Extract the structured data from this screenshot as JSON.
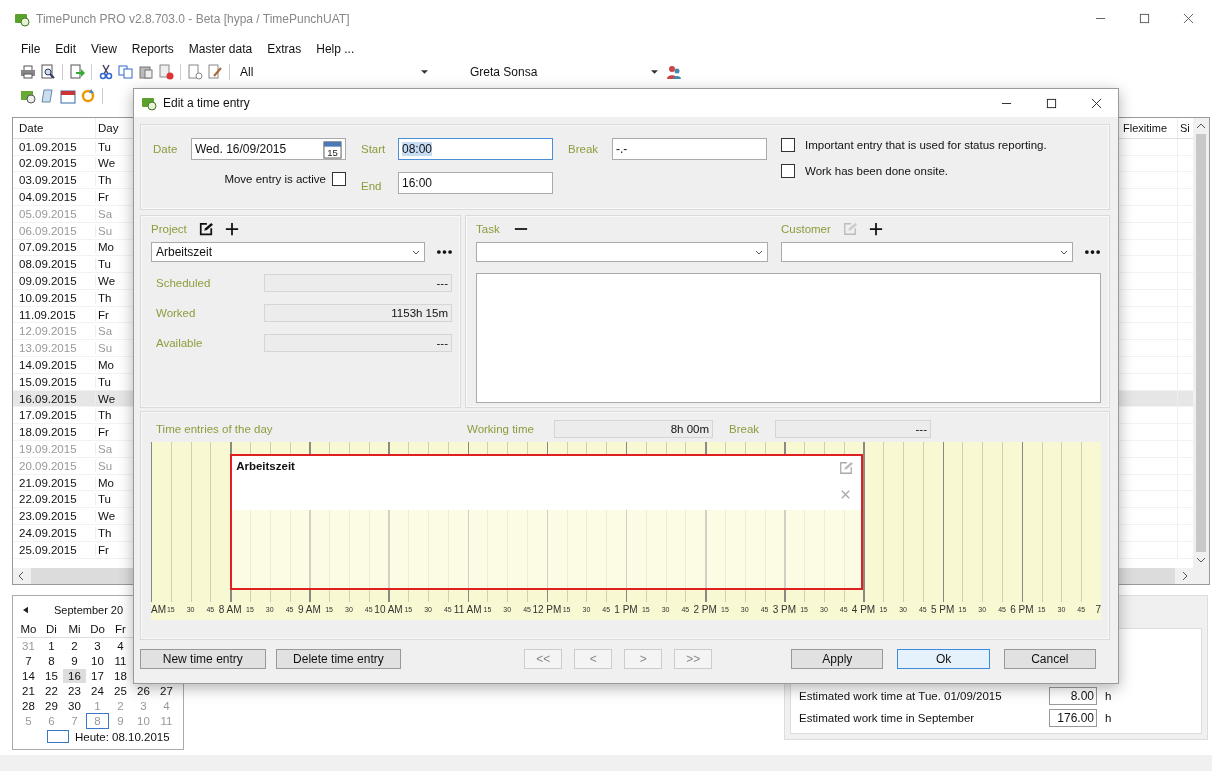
{
  "window": {
    "title": "TimePunch PRO v2.8.703.0 - Beta [hypa / TimePunchUAT]"
  },
  "menu": [
    "File",
    "Edit",
    "View",
    "Reports",
    "Master data",
    "Extras",
    "Help ..."
  ],
  "filters": [
    {
      "value": "All"
    },
    {
      "value": "Greta Sonsa"
    }
  ],
  "table": {
    "columns": [
      "Date",
      "Day"
    ],
    "right_columns": [
      "Flexitime",
      "Si"
    ],
    "rows": [
      {
        "date": "01.09.2015",
        "day": "Tu",
        "weekend": false,
        "selected": false
      },
      {
        "date": "02.09.2015",
        "day": "We",
        "weekend": false,
        "selected": false
      },
      {
        "date": "03.09.2015",
        "day": "Th",
        "weekend": false,
        "selected": false
      },
      {
        "date": "04.09.2015",
        "day": "Fr",
        "weekend": false,
        "selected": false
      },
      {
        "date": "05.09.2015",
        "day": "Sa",
        "weekend": true,
        "selected": false
      },
      {
        "date": "06.09.2015",
        "day": "Su",
        "weekend": true,
        "selected": false
      },
      {
        "date": "07.09.2015",
        "day": "Mo",
        "weekend": false,
        "selected": false
      },
      {
        "date": "08.09.2015",
        "day": "Tu",
        "weekend": false,
        "selected": false
      },
      {
        "date": "09.09.2015",
        "day": "We",
        "weekend": false,
        "selected": false
      },
      {
        "date": "10.09.2015",
        "day": "Th",
        "weekend": false,
        "selected": false
      },
      {
        "date": "11.09.2015",
        "day": "Fr",
        "weekend": false,
        "selected": false
      },
      {
        "date": "12.09.2015",
        "day": "Sa",
        "weekend": true,
        "selected": false
      },
      {
        "date": "13.09.2015",
        "day": "Su",
        "weekend": true,
        "selected": false
      },
      {
        "date": "14.09.2015",
        "day": "Mo",
        "weekend": false,
        "selected": false
      },
      {
        "date": "15.09.2015",
        "day": "Tu",
        "weekend": false,
        "selected": false
      },
      {
        "date": "16.09.2015",
        "day": "We",
        "weekend": false,
        "selected": true
      },
      {
        "date": "17.09.2015",
        "day": "Th",
        "weekend": false,
        "selected": false
      },
      {
        "date": "18.09.2015",
        "day": "Fr",
        "weekend": false,
        "selected": false
      },
      {
        "date": "19.09.2015",
        "day": "Sa",
        "weekend": true,
        "selected": false
      },
      {
        "date": "20.09.2015",
        "day": "Su",
        "weekend": true,
        "selected": false
      },
      {
        "date": "21.09.2015",
        "day": "Mo",
        "weekend": false,
        "selected": false
      },
      {
        "date": "22.09.2015",
        "day": "Tu",
        "weekend": false,
        "selected": false
      },
      {
        "date": "23.09.2015",
        "day": "We",
        "weekend": false,
        "selected": false
      },
      {
        "date": "24.09.2015",
        "day": "Th",
        "weekend": false,
        "selected": false
      },
      {
        "date": "25.09.2015",
        "day": "Fr",
        "weekend": false,
        "selected": false
      }
    ]
  },
  "calendar": {
    "month": "September 20",
    "weekdays": [
      "Mo",
      "Di",
      "Mi",
      "Do",
      "Fr"
    ],
    "weeks": [
      [
        {
          "d": "31",
          "muted": true,
          "selected": false,
          "today": false
        },
        {
          "d": "1",
          "muted": false,
          "selected": false,
          "today": false
        },
        {
          "d": "2",
          "muted": false,
          "selected": false,
          "today": false
        },
        {
          "d": "3",
          "muted": false,
          "selected": false,
          "today": false
        },
        {
          "d": "4",
          "muted": false,
          "selected": false,
          "today": false
        }
      ],
      [
        {
          "d": "7",
          "muted": false,
          "selected": false,
          "today": false
        },
        {
          "d": "8",
          "muted": false,
          "selected": false,
          "today": false
        },
        {
          "d": "9",
          "muted": false,
          "selected": false,
          "today": false
        },
        {
          "d": "10",
          "muted": false,
          "selected": false,
          "today": false
        },
        {
          "d": "11",
          "muted": false,
          "selected": false,
          "today": false
        }
      ],
      [
        {
          "d": "14",
          "muted": false,
          "selected": false,
          "today": false
        },
        {
          "d": "15",
          "muted": false,
          "selected": false,
          "today": false
        },
        {
          "d": "16",
          "muted": false,
          "selected": true,
          "today": false
        },
        {
          "d": "17",
          "muted": false,
          "selected": false,
          "today": false
        },
        {
          "d": "18",
          "muted": false,
          "selected": false,
          "today": false
        }
      ],
      [
        {
          "d": "21",
          "muted": false,
          "selected": false,
          "today": false
        },
        {
          "d": "22",
          "muted": false,
          "selected": false,
          "today": false
        },
        {
          "d": "23",
          "muted": false,
          "selected": false,
          "today": false
        },
        {
          "d": "24",
          "muted": false,
          "selected": false,
          "today": false
        },
        {
          "d": "25",
          "muted": false,
          "selected": false,
          "today": false
        },
        {
          "d": "26",
          "muted": false,
          "selected": false,
          "today": false
        },
        {
          "d": "27",
          "muted": false,
          "selected": false,
          "today": false
        }
      ],
      [
        {
          "d": "28",
          "muted": false,
          "selected": false,
          "today": false
        },
        {
          "d": "29",
          "muted": false,
          "selected": false,
          "today": false
        },
        {
          "d": "30",
          "muted": false,
          "selected": false,
          "today": false
        },
        {
          "d": "1",
          "muted": true,
          "selected": false,
          "today": false
        },
        {
          "d": "2",
          "muted": true,
          "selected": false,
          "today": false
        },
        {
          "d": "3",
          "muted": true,
          "selected": false,
          "today": false
        },
        {
          "d": "4",
          "muted": true,
          "selected": false,
          "today": false
        }
      ],
      [
        {
          "d": "5",
          "muted": true,
          "selected": false,
          "today": false
        },
        {
          "d": "6",
          "muted": true,
          "selected": false,
          "today": false
        },
        {
          "d": "7",
          "muted": true,
          "selected": false,
          "today": false
        },
        {
          "d": "8",
          "muted": true,
          "selected": false,
          "today": true
        },
        {
          "d": "9",
          "muted": true,
          "selected": false,
          "today": false
        },
        {
          "d": "10",
          "muted": true,
          "selected": false,
          "today": false
        },
        {
          "d": "11",
          "muted": true,
          "selected": false,
          "today": false
        }
      ]
    ],
    "today_label": "Heute: 08.10.2015"
  },
  "estimates": [
    {
      "label": "Estimated work time at Tue. 01/09/2015",
      "value": "8.00",
      "unit": "h"
    },
    {
      "label": "Estimated work time in September",
      "value": "176.00",
      "unit": "h"
    }
  ],
  "dialog": {
    "title": "Edit a time entry",
    "date": {
      "label": "Date",
      "value": "Wed. 16/09/2015",
      "icon_day": "15"
    },
    "start": {
      "label": "Start",
      "value": "08:00"
    },
    "end": {
      "label": "End",
      "value": "16:00"
    },
    "break": {
      "label": "Break",
      "value": "-.-"
    },
    "move": {
      "label": "Move entry is active",
      "checked": false
    },
    "options": [
      {
        "label": "Important entry that is used for status reporting.",
        "checked": false
      },
      {
        "label": "Work has been done onsite.",
        "checked": false
      }
    ],
    "project": {
      "label": "Project",
      "value": "Arbeitszeit"
    },
    "stats": [
      {
        "label": "Scheduled",
        "value": "---"
      },
      {
        "label": "Worked",
        "value": "1153h 15m"
      },
      {
        "label": "Available",
        "value": "---"
      }
    ],
    "task": {
      "label": "Task"
    },
    "customer": {
      "label": "Customer"
    },
    "day": {
      "label": "Time entries of the day",
      "working_label": "Working time",
      "working": "8h 00m",
      "break_label": "Break",
      "break": "---"
    },
    "entries": [
      {
        "title": "Arbeitszeit"
      }
    ],
    "axis": [
      "AM",
      "15",
      "30",
      "45",
      "8 AM",
      "15",
      "30",
      "45",
      "9 AM",
      "15",
      "30",
      "45",
      "10 AM",
      "15",
      "30",
      "45",
      "11 AM",
      "15",
      "30",
      "45",
      "12 PM",
      "15",
      "30",
      "45",
      "1 PM",
      "15",
      "30",
      "45",
      "2 PM",
      "15",
      "30",
      "45",
      "3 PM",
      "15",
      "30",
      "45",
      "4 PM",
      "15",
      "30",
      "45",
      "5 PM",
      "15",
      "30",
      "45",
      "6 PM",
      "15",
      "30",
      "45",
      "7"
    ],
    "buttons_left": [
      "New time entry",
      "Delete time entry"
    ],
    "nav": [
      {
        "label": "<<",
        "disabled": true
      },
      {
        "label": "<",
        "disabled": true
      },
      {
        "label": ">",
        "disabled": true
      },
      {
        "label": ">>",
        "disabled": true
      }
    ],
    "buttons_right": [
      {
        "label": "Apply",
        "default": false
      },
      {
        "label": "Ok",
        "default": true
      },
      {
        "label": "Cancel",
        "default": false
      }
    ]
  }
}
